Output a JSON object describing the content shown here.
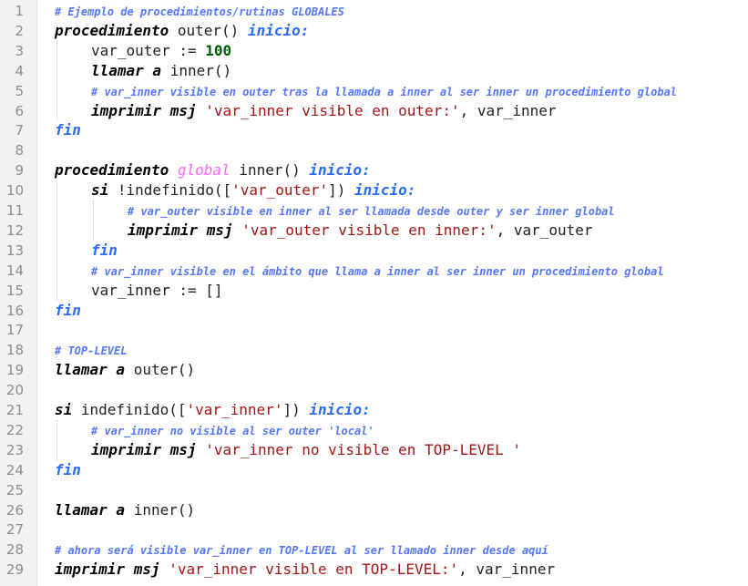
{
  "editor": {
    "lines": [
      {
        "n": "1",
        "indent": 0,
        "tokens": [
          {
            "t": "cmt",
            "v": "# Ejemplo de procedimientos/rutinas GLOBALES"
          }
        ]
      },
      {
        "n": "2",
        "indent": 0,
        "tokens": [
          {
            "t": "kw",
            "v": "procedimiento"
          },
          {
            "t": "tok",
            "v": " outer() "
          },
          {
            "t": "blue",
            "v": "inicio:"
          }
        ]
      },
      {
        "n": "3",
        "indent": 1,
        "tokens": [
          {
            "t": "tok",
            "v": "var_outer "
          },
          {
            "t": "tok",
            "v": ":= "
          },
          {
            "t": "num",
            "v": "100"
          }
        ]
      },
      {
        "n": "4",
        "indent": 1,
        "tokens": [
          {
            "t": "kw",
            "v": "llamar a"
          },
          {
            "t": "tok",
            "v": " inner()"
          }
        ]
      },
      {
        "n": "5",
        "indent": 1,
        "tokens": [
          {
            "t": "cmt",
            "v": "# var_inner visible en outer tras la llamada a inner al ser inner un procedimiento global"
          }
        ]
      },
      {
        "n": "6",
        "indent": 1,
        "tokens": [
          {
            "t": "kw",
            "v": "imprimir msj"
          },
          {
            "t": "tok",
            "v": " "
          },
          {
            "t": "str",
            "v": "'var_inner visible en outer:'"
          },
          {
            "t": "tok",
            "v": ", var_inner"
          }
        ]
      },
      {
        "n": "7",
        "indent": 0,
        "tokens": [
          {
            "t": "blue",
            "v": "fin"
          }
        ]
      },
      {
        "n": "8",
        "indent": 0,
        "tokens": []
      },
      {
        "n": "9",
        "indent": 0,
        "tokens": [
          {
            "t": "kw",
            "v": "procedimiento"
          },
          {
            "t": "tok",
            "v": " "
          },
          {
            "t": "pink",
            "v": "global"
          },
          {
            "t": "tok",
            "v": " inner() "
          },
          {
            "t": "blue",
            "v": "inicio:"
          }
        ]
      },
      {
        "n": "10",
        "indent": 1,
        "tokens": [
          {
            "t": "kw",
            "v": "si"
          },
          {
            "t": "tok",
            "v": " !indefinido(["
          },
          {
            "t": "str",
            "v": "'var_outer'"
          },
          {
            "t": "tok",
            "v": "]) "
          },
          {
            "t": "blue",
            "v": "inicio:"
          }
        ]
      },
      {
        "n": "11",
        "indent": 2,
        "tokens": [
          {
            "t": "cmt",
            "v": "# var_outer visible en inner al ser llamada desde outer y ser inner global"
          }
        ]
      },
      {
        "n": "12",
        "indent": 2,
        "tokens": [
          {
            "t": "kw",
            "v": "imprimir msj"
          },
          {
            "t": "tok",
            "v": " "
          },
          {
            "t": "str",
            "v": "'var_outer visible en inner:'"
          },
          {
            "t": "tok",
            "v": ", var_outer"
          }
        ]
      },
      {
        "n": "13",
        "indent": 1,
        "tokens": [
          {
            "t": "blue",
            "v": "fin"
          }
        ]
      },
      {
        "n": "14",
        "indent": 1,
        "tokens": [
          {
            "t": "cmt",
            "v": "# var_inner visible en el ámbito que llama a inner al ser inner un procedimiento global"
          }
        ]
      },
      {
        "n": "15",
        "indent": 1,
        "tokens": [
          {
            "t": "tok",
            "v": "var_inner := []"
          }
        ]
      },
      {
        "n": "16",
        "indent": 0,
        "tokens": [
          {
            "t": "blue",
            "v": "fin"
          }
        ]
      },
      {
        "n": "17",
        "indent": 0,
        "tokens": []
      },
      {
        "n": "18",
        "indent": 0,
        "tokens": [
          {
            "t": "cmt",
            "v": "# TOP-LEVEL"
          }
        ]
      },
      {
        "n": "19",
        "indent": 0,
        "tokens": [
          {
            "t": "kw",
            "v": "llamar a"
          },
          {
            "t": "tok",
            "v": " outer()"
          }
        ]
      },
      {
        "n": "20",
        "indent": 0,
        "tokens": []
      },
      {
        "n": "21",
        "indent": 0,
        "tokens": [
          {
            "t": "kw",
            "v": "si"
          },
          {
            "t": "tok",
            "v": " indefinido(["
          },
          {
            "t": "str",
            "v": "'var_inner'"
          },
          {
            "t": "tok",
            "v": "]) "
          },
          {
            "t": "blue",
            "v": "inicio:"
          }
        ]
      },
      {
        "n": "22",
        "indent": 1,
        "tokens": [
          {
            "t": "cmt",
            "v": "# var_inner no visible al ser outer 'local'"
          }
        ]
      },
      {
        "n": "23",
        "indent": 1,
        "tokens": [
          {
            "t": "kw",
            "v": "imprimir msj"
          },
          {
            "t": "tok",
            "v": " "
          },
          {
            "t": "str",
            "v": "'var_inner no visible en TOP-LEVEL '"
          }
        ]
      },
      {
        "n": "24",
        "indent": 0,
        "tokens": [
          {
            "t": "blue",
            "v": "fin"
          }
        ]
      },
      {
        "n": "25",
        "indent": 0,
        "tokens": []
      },
      {
        "n": "26",
        "indent": 0,
        "tokens": [
          {
            "t": "kw",
            "v": "llamar a"
          },
          {
            "t": "tok",
            "v": " inner()"
          }
        ]
      },
      {
        "n": "27",
        "indent": 0,
        "tokens": []
      },
      {
        "n": "28",
        "indent": 0,
        "tokens": [
          {
            "t": "cmt",
            "v": "# ahora será visible var_inner en TOP-LEVEL al ser llamado inner desde aquí"
          }
        ]
      },
      {
        "n": "29",
        "indent": 0,
        "tokens": [
          {
            "t": "kw",
            "v": "imprimir msj"
          },
          {
            "t": "tok",
            "v": " "
          },
          {
            "t": "str",
            "v": "'var_inner visible en TOP-LEVEL:'"
          },
          {
            "t": "tok",
            "v": ", var_inner"
          }
        ]
      }
    ]
  }
}
